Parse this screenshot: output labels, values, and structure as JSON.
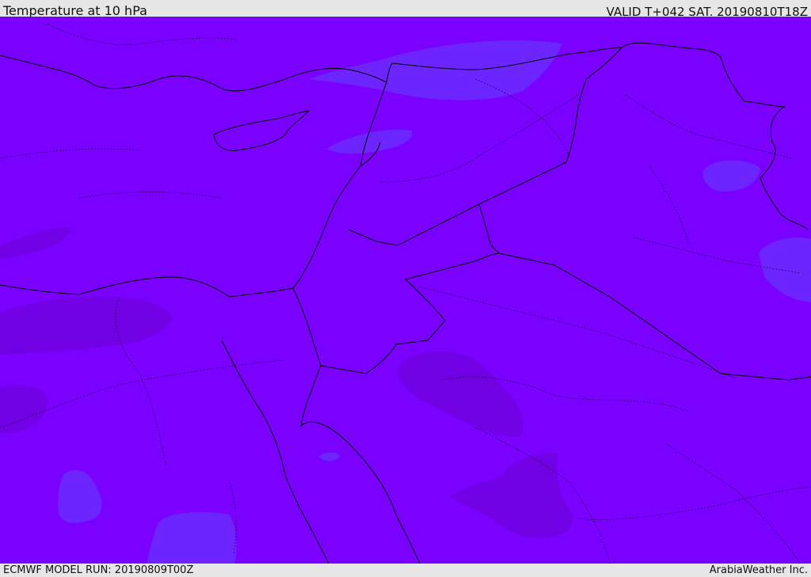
{
  "header": {
    "title": "Temperature at 10 hPa",
    "valid": "VALID T+042 SAT. 20190810T18Z"
  },
  "footer": {
    "model_run": "ECMWF MODEL RUN: 20190809T00Z",
    "credit": "ArabiaWeather Inc."
  },
  "map": {
    "base_color": "#7a00ff",
    "warm_patch_color": "#7000e0",
    "cool_patch_color": "#6a2cff",
    "coastline_color": "#000000",
    "region": "Eastern Mediterranean / Levant / Arabian Peninsula"
  }
}
